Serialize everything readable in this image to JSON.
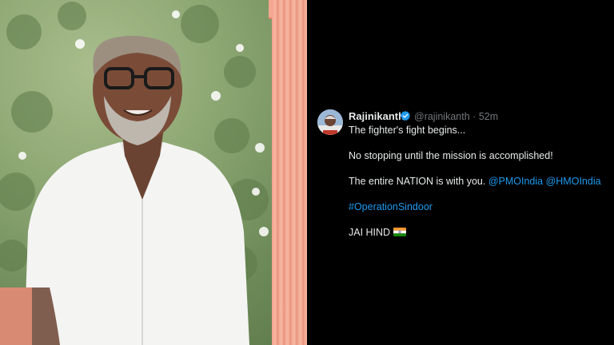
{
  "tweet": {
    "author_name": "Rajinikanth",
    "handle": "@rajinikanth",
    "separator": "·",
    "time_ago": "52m",
    "line1": "The fighter's fight begins...",
    "line2": "No stopping until the mission is accomplished!",
    "line3_text": "The entire NATION is with you. ",
    "mention1": "@PMOIndia",
    "mention2": "@HMOIndia",
    "hashtag": "#OperationSindoor",
    "closing": "JAI HIND"
  },
  "colors": {
    "background": "#000000",
    "text": "#e7e9ea",
    "secondary": "#71767b",
    "link": "#1d9bf0",
    "verified": "#1d9bf0"
  },
  "icons": [
    "verified-badge-icon",
    "indian-flag-icon"
  ]
}
